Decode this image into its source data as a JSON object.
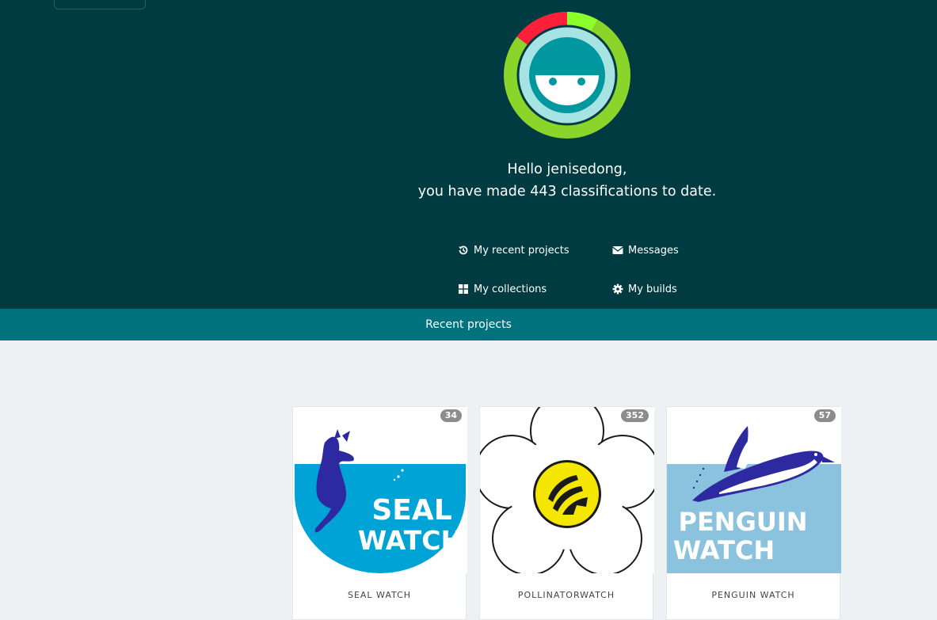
{
  "user": {
    "greeting_line1": "Hello jenisedong,",
    "greeting_line2": "you have made 443 classifications to date."
  },
  "nav": {
    "recent_projects": "My recent projects",
    "messages": "Messages",
    "collections": "My collections",
    "builds": "My builds"
  },
  "section_title": "Recent projects",
  "projects": [
    {
      "name": "SEAL WATCH",
      "count": "34",
      "logo_text": [
        "SEAL",
        "WATCH"
      ]
    },
    {
      "name": "POLLINATORWATCH",
      "count": "352"
    },
    {
      "name": "PENGUIN WATCH",
      "count": "57",
      "logo_text": [
        "PENGUIN",
        "WATCH"
      ]
    }
  ],
  "colors": {
    "hero_bg": "#003b42",
    "band_bg": "#00727e",
    "ring_green": "#8bd52b",
    "ring_red": "#ff1f3a",
    "ring_light": "#8aff2c",
    "page_bg": "#eef1f4"
  }
}
